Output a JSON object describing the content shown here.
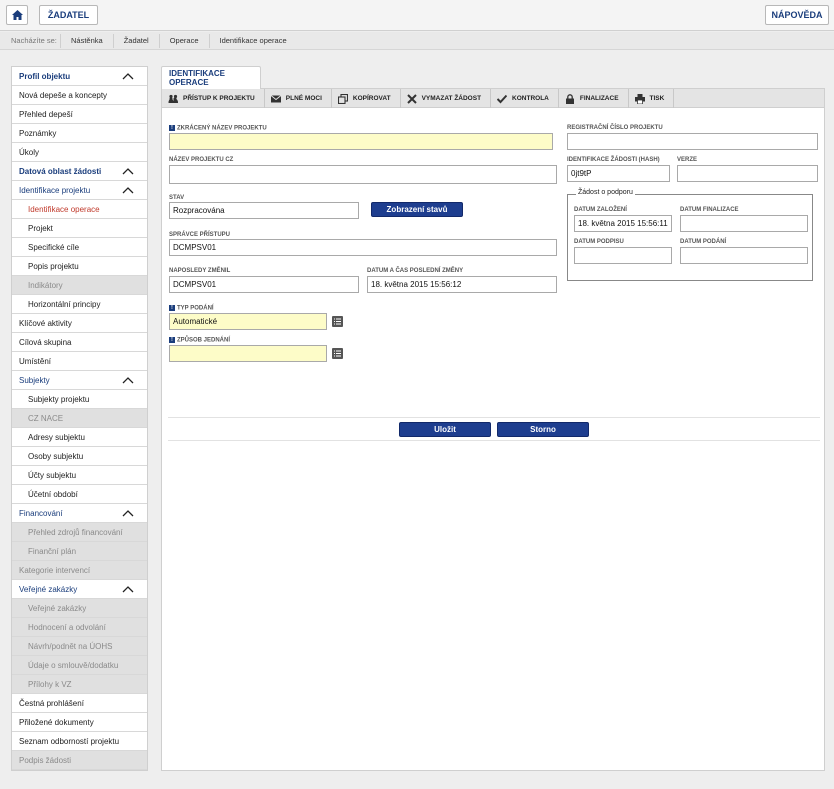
{
  "topbar": {
    "applicant_label": "ŽADATEL",
    "help_label": "NÁPOVĚDA"
  },
  "breadcrumb": {
    "label": "Nacházíte se:",
    "items": [
      "Nástěnka",
      "Žadatel",
      "Operace",
      "Identifikace operace"
    ]
  },
  "sidebar": {
    "items": [
      {
        "label": "Profil objektu",
        "type": "head",
        "chevron": true
      },
      {
        "label": "Nová depeše a koncepty",
        "type": "top"
      },
      {
        "label": "Přehled depeší",
        "type": "top"
      },
      {
        "label": "Poznámky",
        "type": "top"
      },
      {
        "label": "Úkoly",
        "type": "top"
      },
      {
        "label": "Datová oblast žádosti",
        "type": "head",
        "chevron": true
      },
      {
        "label": "Identifikace projektu",
        "type": "group",
        "chevron": true
      },
      {
        "label": "Identifikace operace",
        "type": "active"
      },
      {
        "label": "Projekt",
        "type": "sub"
      },
      {
        "label": "Specifické cíle",
        "type": "sub"
      },
      {
        "label": "Popis projektu",
        "type": "sub"
      },
      {
        "label": "Indikátory",
        "type": "dsub"
      },
      {
        "label": "Horizontální principy",
        "type": "sub"
      },
      {
        "label": "Klíčové aktivity",
        "type": "top"
      },
      {
        "label": "Cílová skupina",
        "type": "top"
      },
      {
        "label": "Umístění",
        "type": "top"
      },
      {
        "label": "Subjekty",
        "type": "group",
        "chevron": true
      },
      {
        "label": "Subjekty projektu",
        "type": "sub"
      },
      {
        "label": "CZ NACE",
        "type": "dsub"
      },
      {
        "label": "Adresy subjektu",
        "type": "sub"
      },
      {
        "label": "Osoby subjektu",
        "type": "sub"
      },
      {
        "label": "Účty subjektu",
        "type": "sub"
      },
      {
        "label": "Účetní období",
        "type": "sub"
      },
      {
        "label": "Financování",
        "type": "group",
        "chevron": true
      },
      {
        "label": "Přehled zdrojů financování",
        "type": "dsub"
      },
      {
        "label": "Finanční plán",
        "type": "dsub"
      },
      {
        "label": "Kategorie intervencí",
        "type": "dtop"
      },
      {
        "label": "Veřejné zakázky",
        "type": "group",
        "chevron": true
      },
      {
        "label": "Veřejné zakázky",
        "type": "dsub"
      },
      {
        "label": "Hodnocení a odvolání",
        "type": "dsub"
      },
      {
        "label": "Návrh/podnět na ÚOHS",
        "type": "dsub"
      },
      {
        "label": "Údaje o smlouvě/dodatku",
        "type": "dsub"
      },
      {
        "label": "Přílohy k VZ",
        "type": "dsub"
      },
      {
        "label": "Čestná prohlášení",
        "type": "top"
      },
      {
        "label": "Přiložené dokumenty",
        "type": "top"
      },
      {
        "label": "Seznam odborností projektu",
        "type": "top"
      },
      {
        "label": "Podpis žádosti",
        "type": "dtop"
      }
    ]
  },
  "main": {
    "tab_label": "IDENTIFIKACE OPERACE",
    "toolbar": [
      {
        "label": "PŘÍSTUP K PROJEKTU",
        "icon": "users-icon"
      },
      {
        "label": "PLNÉ MOCI",
        "icon": "envelope-icon"
      },
      {
        "label": "KOPÍROVAT",
        "icon": "copy-icon"
      },
      {
        "label": "VYMAZAT ŽÁDOST",
        "icon": "delete-icon"
      },
      {
        "label": "KONTROLA",
        "icon": "check-icon"
      },
      {
        "label": "FINALIZACE",
        "icon": "lock-icon"
      },
      {
        "label": "TISK",
        "icon": "print-icon"
      }
    ],
    "form": {
      "short_name_label": "ZKRÁCENÝ NÁZEV PROJEKTU",
      "short_name_value": "",
      "reg_number_label": "REGISTRAČNÍ ČÍSLO PROJEKTU",
      "reg_number_value": "",
      "name_cz_label": "NÁZEV PROJEKTU CZ",
      "name_cz_value": "",
      "hash_label": "IDENTIFIKACE ŽÁDOSTI (HASH)",
      "hash_value": "0jt9tP",
      "version_label": "VERZE",
      "version_value": "",
      "state_label": "STAV",
      "state_value": "Rozpracována",
      "show_states_label": "Zobrazení stavů",
      "admin_label": "SPRÁVCE PŘÍSTUPU",
      "admin_value": "DCMPSV01",
      "last_changed_by_label": "NAPOSLEDY ZMĚNIL",
      "last_changed_by_value": "DCMPSV01",
      "last_change_label": "DATUM A ČAS POSLEDNÍ ZMĚNY",
      "last_change_value": "18. května 2015 15:56:12",
      "submission_type_label": "TYP PODÁNÍ",
      "submission_type_value": "Automatické",
      "negotiation_label": "ZPŮSOB JEDNÁNÍ",
      "negotiation_value": ""
    },
    "support_request": {
      "legend": "Žádost o podporu",
      "created_label": "DATUM ZALOŽENÍ",
      "created_value": "18. května 2015 15:56:11",
      "finalized_label": "DATUM FINALIZACE",
      "finalized_value": "",
      "signed_label": "DATUM PODPISU",
      "signed_value": "",
      "submitted_label": "DATUM PODÁNÍ",
      "submitted_value": ""
    },
    "save_label": "Uložit",
    "cancel_label": "Storno"
  }
}
